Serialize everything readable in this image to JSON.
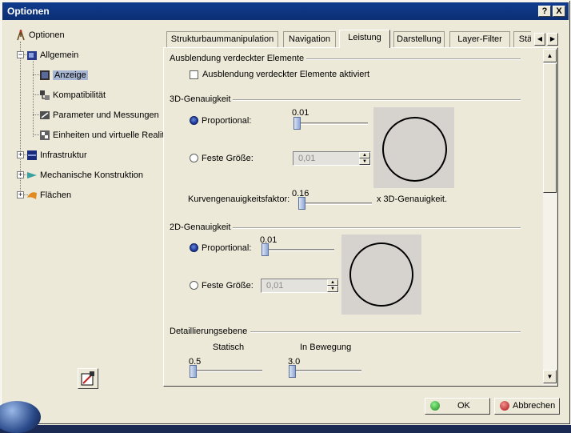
{
  "window": {
    "title": "Optionen",
    "help_label": "?",
    "close_label": "X"
  },
  "tree": {
    "root": "Optionen",
    "allgemein": "Allgemein",
    "children": [
      "Anzeige",
      "Kompatibilität",
      "Parameter und Messungen",
      "Einheiten und virtuelle Realit"
    ],
    "others": [
      "Infrastruktur",
      "Mechanische Konstruktion",
      "Flächen"
    ]
  },
  "tabs": [
    "Strukturbaummanipulation",
    "Navigation",
    "Leistung",
    "Darstellung",
    "Layer-Filter",
    "Stä"
  ],
  "active_tab": "Leistung",
  "sections": {
    "hidden": {
      "title": "Ausblendung verdeckter Elemente",
      "checkbox_label": "Ausblendung verdeckter Elemente aktiviert",
      "checked": false
    },
    "accuracy3d": {
      "title": "3D-Genauigkeit",
      "proportional_label": "Proportional:",
      "proportional_value": "0.01",
      "fixed_label": "Feste Größe:",
      "fixed_value": "0,01",
      "curve_label": "Kurvengenauigkeitsfaktor:",
      "curve_value": "0.16",
      "curve_suffix": "x 3D-Genauigkeit."
    },
    "accuracy2d": {
      "title": "2D-Genauigkeit",
      "proportional_label": "Proportional:",
      "proportional_value": "0.01",
      "fixed_label": "Feste Größe:",
      "fixed_value": "0,01"
    },
    "detail": {
      "title": "Detaillierungsebene",
      "static_label": "Statisch",
      "static_value": "0.5",
      "moving_label": "In Bewegung",
      "moving_value": "3.0"
    }
  },
  "buttons": {
    "ok": "OK",
    "cancel": "Abbrechen"
  },
  "colors": {
    "title_bar": "#0c2f74",
    "selection": "#a6b5d2",
    "dialog": "#ece9d8",
    "ok_icon": "#2aa02a",
    "cancel_icon": "#d02020"
  }
}
